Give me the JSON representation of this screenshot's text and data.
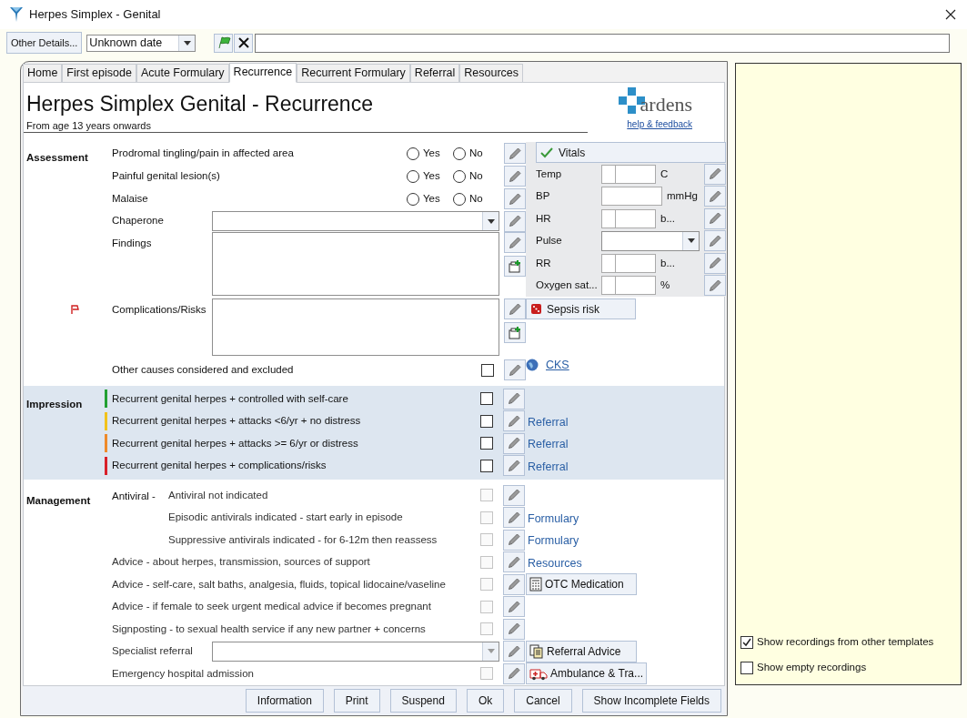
{
  "window": {
    "title": "Herpes Simplex - Genital"
  },
  "toolbar": {
    "other_details": "Other Details...",
    "date": {
      "value": "Unknown date"
    }
  },
  "tabs": [
    {
      "label": "Home",
      "selected": false
    },
    {
      "label": "First episode",
      "selected": false
    },
    {
      "label": "Acute Formulary",
      "selected": false
    },
    {
      "label": "Recurrence",
      "selected": true
    },
    {
      "label": "Recurrent Formulary",
      "selected": false
    },
    {
      "label": "Referral",
      "selected": false
    },
    {
      "label": "Resources",
      "selected": false
    }
  ],
  "header": {
    "title": "Herpes Simplex Genital - Recurrence",
    "subtitle": "From age 13 years onwards",
    "logo": "ardens",
    "help_link": "help & feedback"
  },
  "assessment": {
    "label": "Assessment",
    "rows": [
      {
        "kind": "yesno",
        "label": "Prodromal tingling/pain in affected area",
        "options": [
          {
            "label": "Yes",
            "selected": false
          },
          {
            "label": "No",
            "selected": false
          }
        ]
      },
      {
        "kind": "yesno",
        "label": "Painful genital lesion(s)",
        "options": [
          {
            "label": "Yes",
            "selected": false
          },
          {
            "label": "No",
            "selected": false
          }
        ]
      },
      {
        "kind": "yesno",
        "label": "Malaise",
        "options": [
          {
            "label": "Yes",
            "selected": false
          },
          {
            "label": "No",
            "selected": false
          }
        ]
      },
      {
        "kind": "dropdown",
        "label": "Chaperone"
      },
      {
        "kind": "text",
        "label": "Findings",
        "flagged": false
      },
      {
        "kind": "text",
        "label": "Complications/Risks",
        "flagged": true
      },
      {
        "kind": "check",
        "label": "Other causes considered and excluded",
        "checked": false
      }
    ]
  },
  "vitals": {
    "title": "Vitals",
    "rows": [
      {
        "kind": "split",
        "label": "Temp",
        "unit": "C"
      },
      {
        "kind": "input",
        "label": "BP",
        "unit": "mmHg"
      },
      {
        "kind": "split",
        "label": "HR",
        "unit": "b..."
      },
      {
        "kind": "dropdown",
        "label": "Pulse"
      },
      {
        "kind": "split",
        "label": "RR",
        "unit": "b..."
      },
      {
        "kind": "split",
        "label": "Oxygen sat...",
        "unit": "%"
      }
    ]
  },
  "sepsis_button": "Sepsis risk",
  "cks_link": "CKS",
  "impression": {
    "label": "Impression",
    "rows": [
      {
        "label": "Recurrent genital herpes + controlled with self-care",
        "color": "#22a033",
        "checked": false
      },
      {
        "label": "Recurrent genital herpes + attacks <6/yr + no distress",
        "color": "#f2c21b",
        "checked": false,
        "link": "Referral"
      },
      {
        "label": "Recurrent genital herpes + attacks >= 6/yr or distress",
        "color": "#ee8a2a",
        "checked": false,
        "link": "Referral"
      },
      {
        "label": "Recurrent genital herpes + complications/risks",
        "color": "#d8202a",
        "checked": false,
        "link": "Referral"
      }
    ]
  },
  "management": {
    "label": "Management",
    "rows": [
      {
        "kind": "group",
        "label": "Antiviral -",
        "children": [
          {
            "label": "Antiviral not indicated",
            "checked": false
          },
          {
            "label": "Episodic antivirals indicated - start early in episode",
            "checked": false,
            "extra": {
              "kind": "link",
              "text": "Formulary"
            }
          },
          {
            "label": "Suppressive antivirals indicated - for 6-12m then reassess",
            "checked": false,
            "extra": {
              "kind": "link",
              "text": "Formulary"
            }
          }
        ]
      },
      {
        "kind": "check",
        "label": "Advice - about herpes, transmission, sources of support",
        "checked": false,
        "extra": {
          "kind": "link",
          "text": "Resources"
        }
      },
      {
        "kind": "check",
        "label": "Advice - self-care, salt baths, analgesia, fluids, topical lidocaine/vaseline",
        "checked": false,
        "extra": {
          "kind": "button",
          "text": "OTC Medication"
        }
      },
      {
        "kind": "check",
        "label": "Advice - if female to seek urgent medical advice if becomes pregnant",
        "checked": false
      },
      {
        "kind": "check",
        "label": "Signposting - to sexual health service if any new partner + concerns",
        "checked": false
      },
      {
        "kind": "dropdown",
        "label": "Specialist referral",
        "extra": {
          "kind": "button",
          "text": "Referral Advice"
        }
      },
      {
        "kind": "check",
        "label": "Emergency hospital admission",
        "checked": false,
        "extra": {
          "kind": "button",
          "text": "Ambulance & Tra..."
        }
      }
    ]
  },
  "footer_buttons": [
    "Information",
    "Print",
    "Suspend",
    "Ok",
    "Cancel",
    "Show Incomplete Fields"
  ],
  "side_panel": {
    "options": [
      {
        "label": "Show recordings from other templates",
        "checked": true
      },
      {
        "label": "Show empty recordings",
        "checked": false
      }
    ]
  }
}
